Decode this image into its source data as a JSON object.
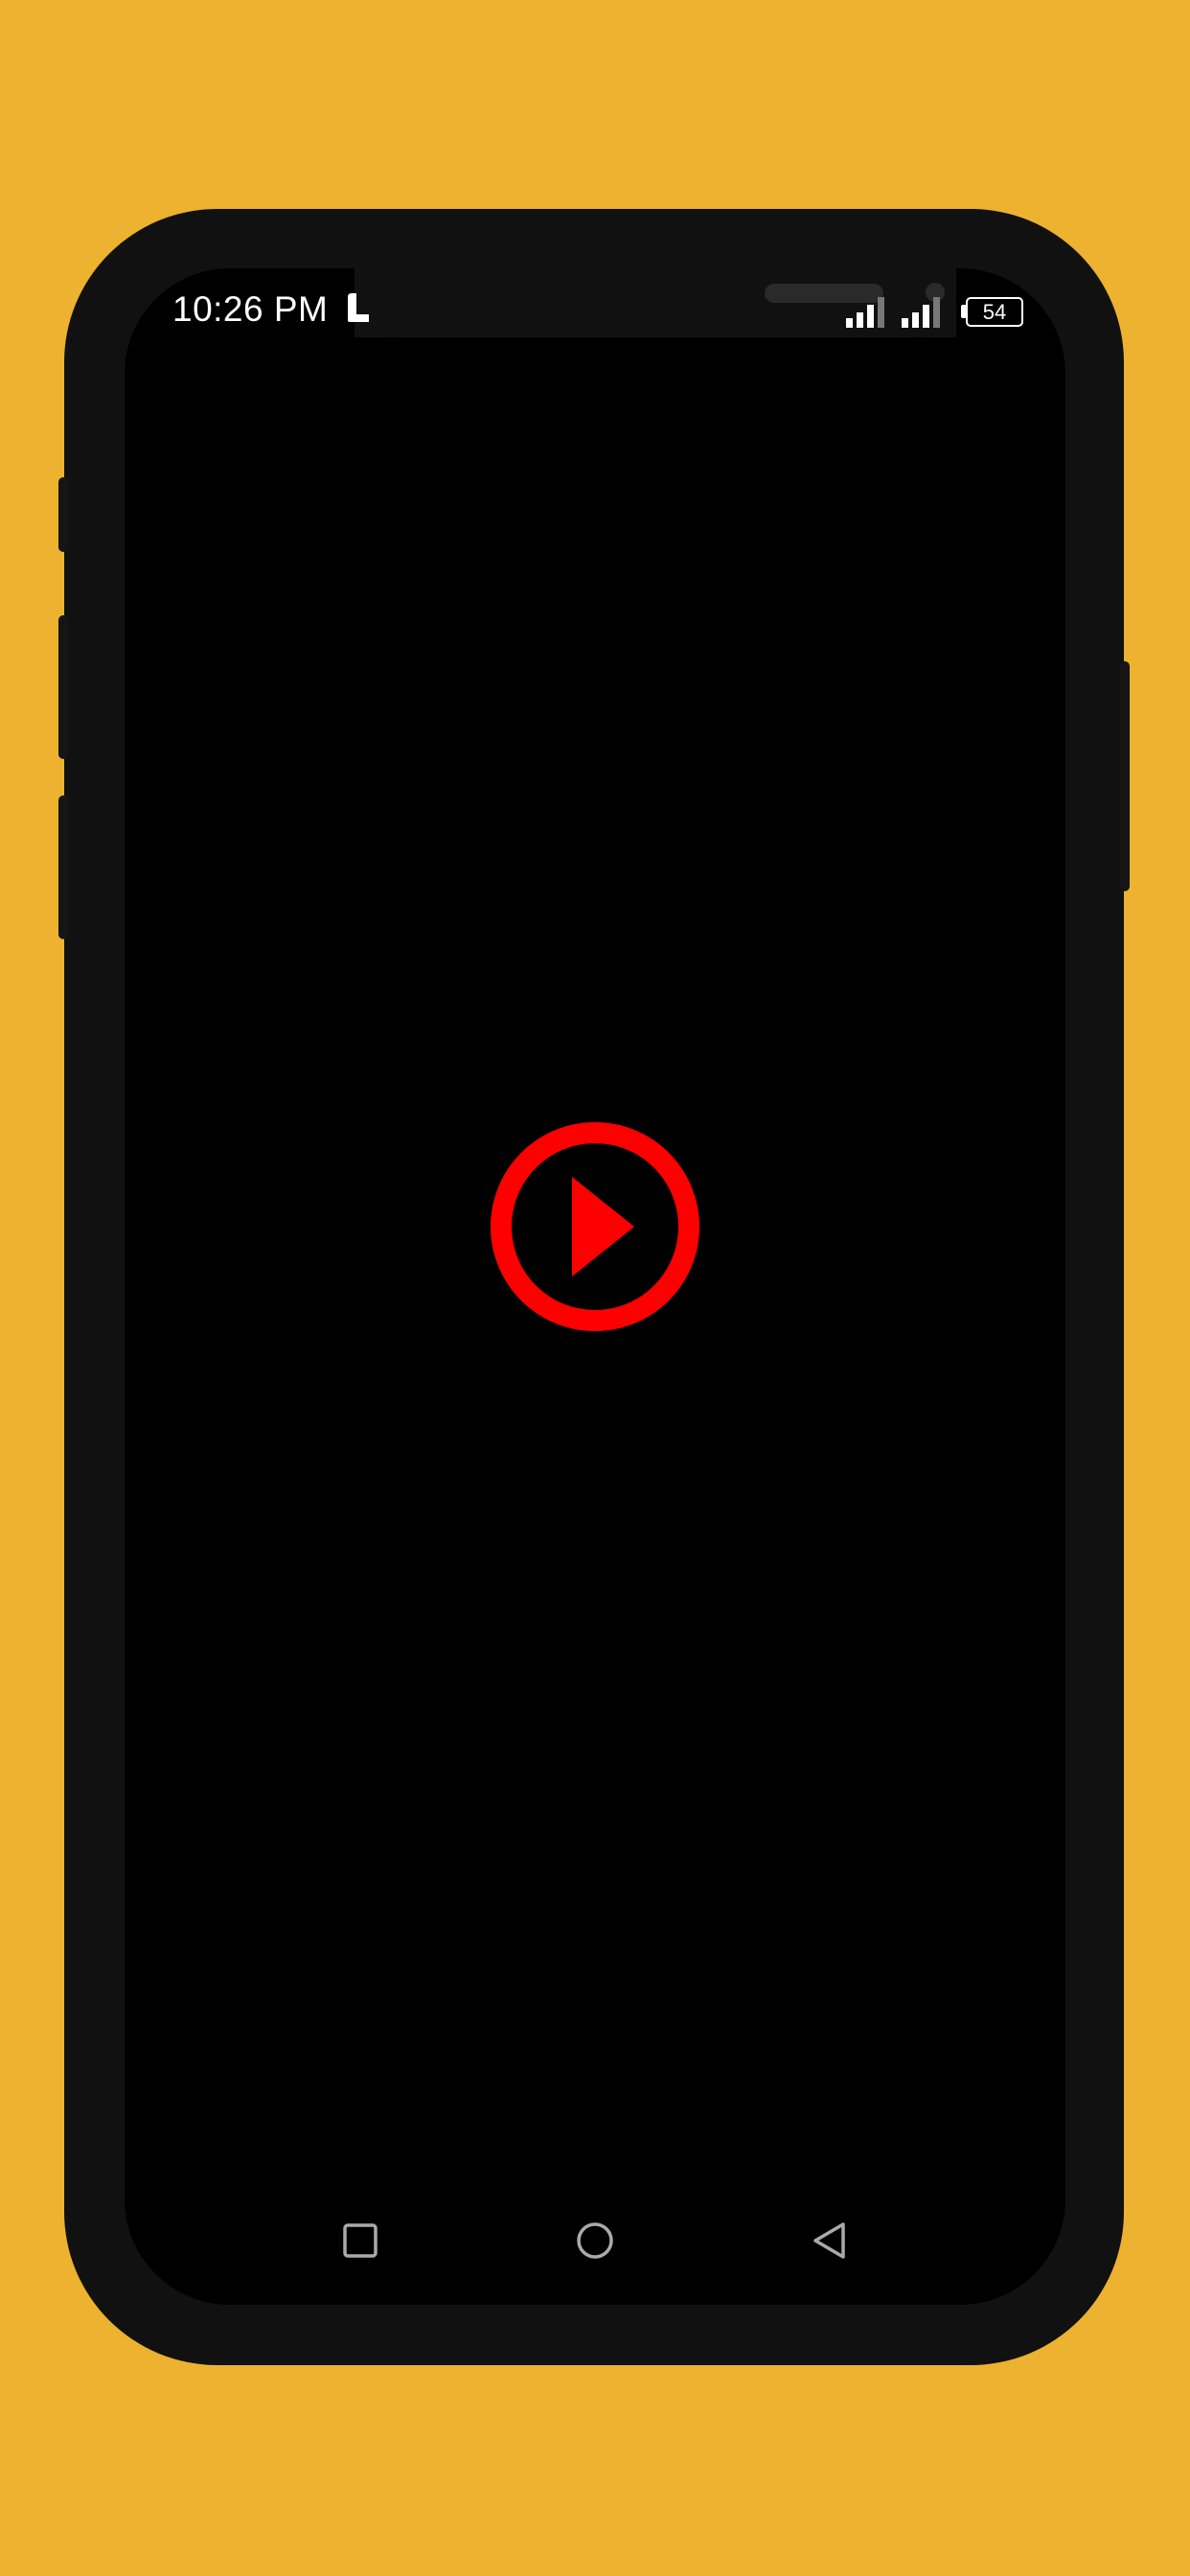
{
  "status_bar": {
    "time": "10:26 PM",
    "battery_level": "54",
    "notification_icon": "notification-icon",
    "signal_icons": [
      "signal-icon",
      "signal-icon"
    ]
  },
  "player": {
    "play_icon": "play-circle-icon",
    "accent_color": "#FF0000"
  },
  "nav_bar": {
    "recents_icon": "square-icon",
    "home_icon": "circle-icon",
    "back_icon": "triangle-back-icon"
  },
  "colors": {
    "background": "#EDB22F",
    "frame": "#111111",
    "screen": "#000000"
  }
}
